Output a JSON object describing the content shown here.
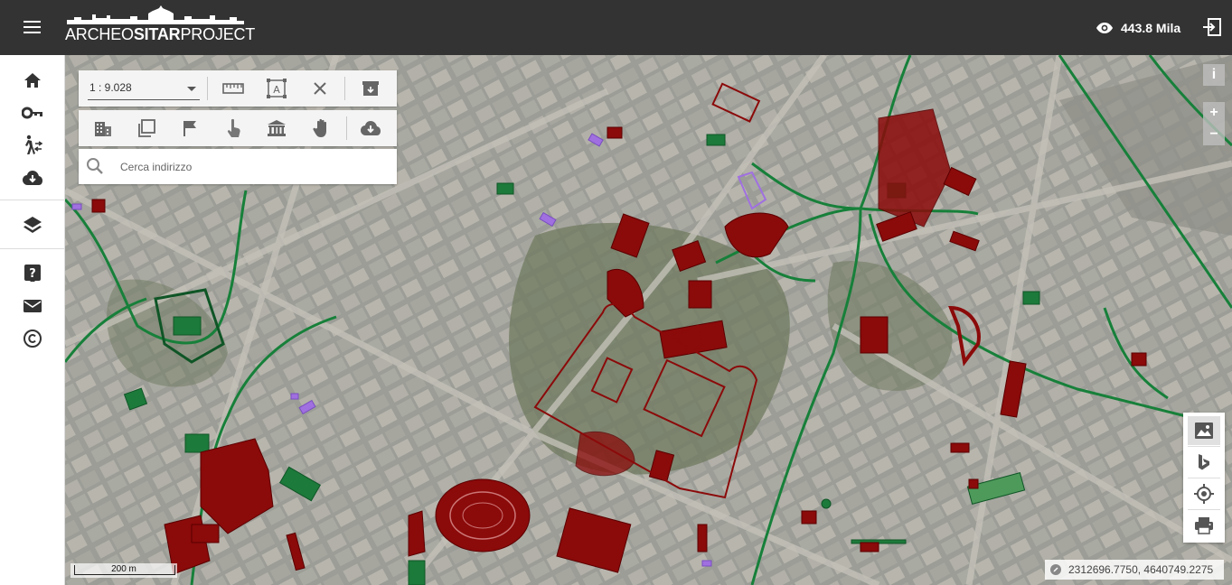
{
  "app": {
    "logo_prefix": "ARCHEO",
    "logo_bold": "SITAR",
    "logo_suffix": "PROJECT",
    "views_count": "443.8 Mila"
  },
  "sidebar": {
    "items": [
      {
        "name": "home",
        "icon": "home-icon"
      },
      {
        "name": "login",
        "icon": "key-icon"
      },
      {
        "name": "accessibility",
        "icon": "walking-person-icon"
      },
      {
        "name": "download",
        "icon": "cloud-download-icon"
      },
      {
        "name": "layers",
        "icon": "layers-icon"
      },
      {
        "name": "help",
        "icon": "help-icon"
      },
      {
        "name": "contact",
        "icon": "mail-icon"
      },
      {
        "name": "copyright",
        "icon": "copyright-icon"
      }
    ]
  },
  "toolbar": {
    "scale_value": "1 : 9.028",
    "search_placeholder": "Cerca indirizzo",
    "tools_row1": [
      "ruler-icon",
      "text-frame-icon",
      "close-icon",
      "archive-icon"
    ],
    "tools_row2": [
      "building-icon",
      "copy-layers-icon",
      "flag-icon",
      "touch-icon",
      "museum-icon",
      "hand-icon",
      "cloud-download-icon"
    ]
  },
  "map": {
    "scale_label": "200 m",
    "coordinates": "2312696.7750, 4640749.2275",
    "controls": [
      "info-icon",
      "zoom-in-icon",
      "zoom-out-icon"
    ],
    "right_panel": [
      "image-layer-icon",
      "bing-icon",
      "locate-icon",
      "print-icon"
    ],
    "controls_text": {
      "info": "i",
      "zoom_in": "+",
      "zoom_out": "−"
    },
    "colors": {
      "archaeology_red": "#8b0a0a",
      "route_green": "#17803a",
      "highlight_purple": "#a070e0"
    }
  }
}
